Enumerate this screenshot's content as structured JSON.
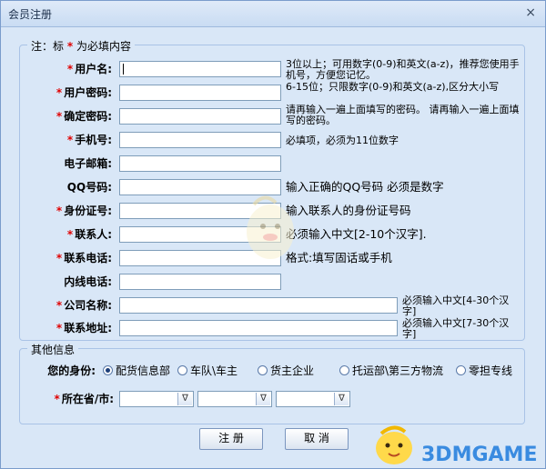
{
  "window": {
    "title": "会员注册",
    "close_glyph": "×"
  },
  "note": {
    "prefix": "注：标",
    "star": "*",
    "suffix": "为必填内容"
  },
  "fields": [
    {
      "label": "用户名:",
      "required": true,
      "hint": "3位以上；可用数字(0-9)和英文(a-z)，推荐您使用手机号，方便您记忆。"
    },
    {
      "label": "用户密码:",
      "required": true,
      "hint": "6-15位；只限数字(0-9)和英文(a-z),区分大小写"
    },
    {
      "label": "确定密码:",
      "required": true,
      "hint": "请再输入一遍上面填写的密码。 请再输入一遍上面填写的密码。"
    },
    {
      "label": "手机号:",
      "required": true,
      "hint": "必填项，必须为11位数字"
    },
    {
      "label": "电子邮箱:",
      "required": false,
      "hint": ""
    },
    {
      "label": "QQ号码:",
      "required": false,
      "hint": "输入正确的QQ号码 必须是数字"
    },
    {
      "label": "身份证号:",
      "required": true,
      "hint": "输入联系人的身份证号码"
    },
    {
      "label": "联系人:",
      "required": true,
      "hint": "必须输入中文[2-10个汉字]."
    },
    {
      "label": "联系电话:",
      "required": true,
      "hint": "格式:填写固话或手机"
    },
    {
      "label": "内线电话:",
      "required": false,
      "hint": ""
    },
    {
      "label": "公司名称:",
      "required": true,
      "hint": "必须输入中文[4-30个汉字]"
    },
    {
      "label": "联系地址:",
      "required": true,
      "hint": "必须输入中文[7-30个汉字]"
    }
  ],
  "other": {
    "legend": "其他信息",
    "identity_label": "您的身份:",
    "identity_options": [
      "配货信息部",
      "车队\\车主",
      "货主企业",
      "托运部\\第三方物流",
      "零担专线"
    ],
    "identity_selected": 0,
    "region_label": "所在省/市:",
    "region_required": true,
    "select_arrow": "∇"
  },
  "buttons": {
    "register": "注 册",
    "cancel": "取 消"
  },
  "watermark": "3DMGAME",
  "colors": {
    "required_star": "#e00000",
    "window_bg": "#d9e7f7",
    "border": "#a9c3e6"
  }
}
